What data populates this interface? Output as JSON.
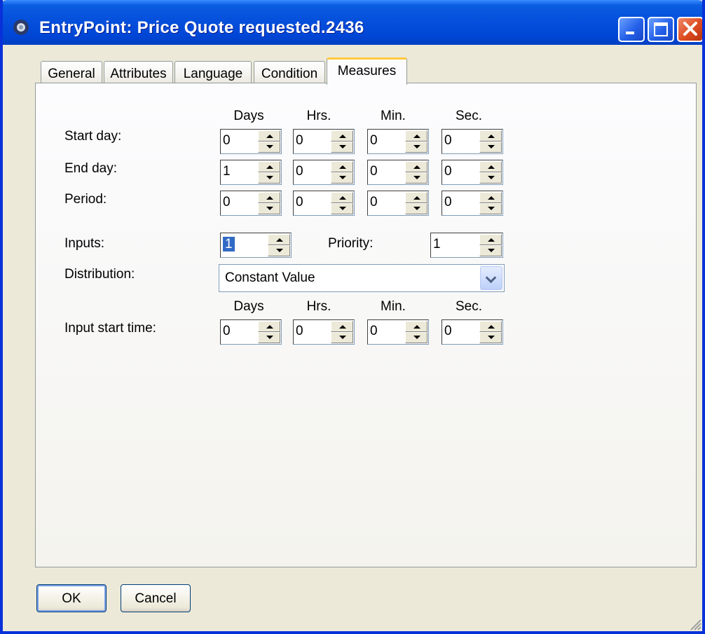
{
  "window": {
    "title": "EntryPoint: Price Quote requested.2436"
  },
  "tabs": [
    {
      "label": "General"
    },
    {
      "label": "Attributes"
    },
    {
      "label": "Language"
    },
    {
      "label": "Condition"
    },
    {
      "label": "Measures",
      "active": true
    }
  ],
  "columns": [
    "Days",
    "Hrs.",
    "Min.",
    "Sec."
  ],
  "rows": [
    {
      "label": "Start day:",
      "values": [
        "0",
        "0",
        "0",
        "0"
      ]
    },
    {
      "label": "End day:",
      "values": [
        "1",
        "0",
        "0",
        "0"
      ]
    },
    {
      "label": "Period:",
      "values": [
        "0",
        "0",
        "0",
        "0"
      ]
    }
  ],
  "inputs": {
    "label": "Inputs:",
    "value": "1"
  },
  "priority": {
    "label": "Priority:",
    "value": "1"
  },
  "distribution": {
    "label": "Distribution:",
    "value": "Constant Value"
  },
  "input_start": {
    "label": "Input start time:",
    "values": [
      "0",
      "0",
      "0",
      "0"
    ]
  },
  "buttons": {
    "ok": "OK",
    "cancel": "Cancel"
  },
  "colors": {
    "titlebar": "#0550dc",
    "active_tab_accent": "#ffc83c",
    "selection": "#316ac5"
  }
}
